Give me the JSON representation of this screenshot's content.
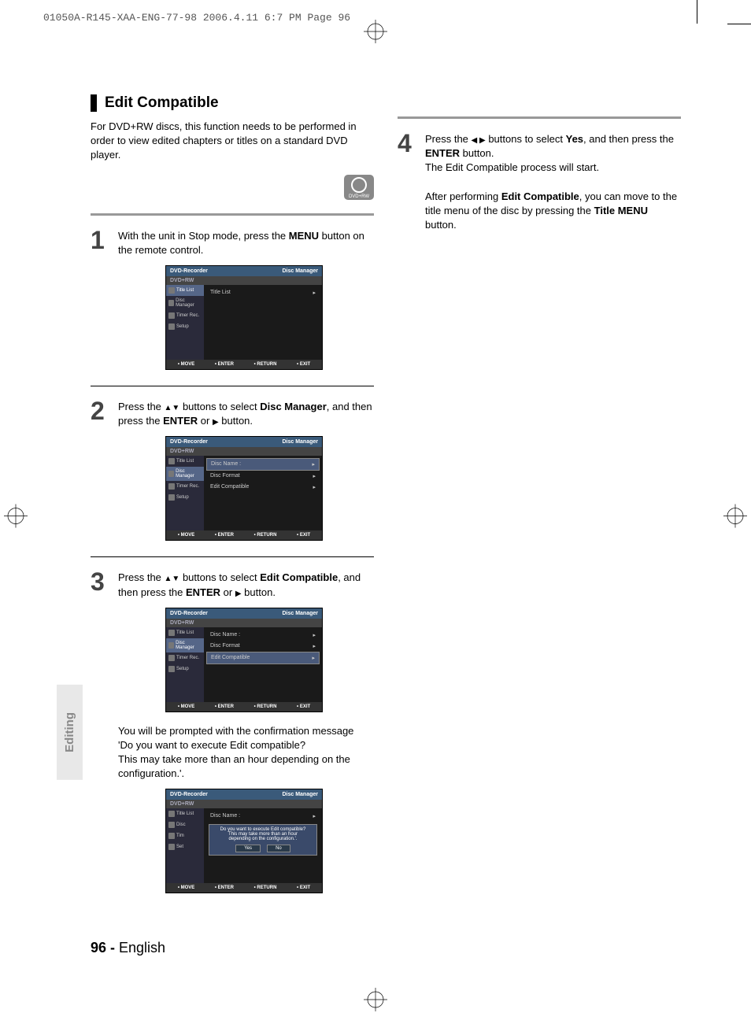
{
  "header": "01050A-R145-XAA-ENG-77-98  2006.4.11  6:7 PM  Page 96",
  "section": {
    "title": "Edit Compatible",
    "intro": "For DVD+RW discs, this function needs to be performed in order to view edited chapters or titles on a standard DVD player.",
    "badge": "DVD+RW"
  },
  "steps": {
    "s1": {
      "num": "1",
      "text_a": "With the unit in Stop mode, press the ",
      "bold_a": "MENU",
      "text_b": " button on the remote control."
    },
    "s2": {
      "num": "2",
      "text_a": "Press the ",
      "arrows_a": "▲▼",
      "text_b": " buttons to select ",
      "bold_a": "Disc Manager",
      "text_c": ", and then press the ",
      "bold_b": "ENTER",
      "text_d": " or ",
      "arrow_b": "▶",
      "text_e": " button."
    },
    "s3": {
      "num": "3",
      "text_a": "Press the ",
      "arrows_a": "▲▼",
      "text_b": " buttons to select ",
      "bold_a": "Edit Compatible",
      "text_c": ", and then press the ",
      "bold_b": "ENTER",
      "text_d": " or ",
      "arrow_b": "▶",
      "text_e": " button."
    },
    "s4": {
      "num": "4",
      "text_a": "Press the ",
      "arrows_a": "◀ ▶",
      "text_b": " buttons to select ",
      "bold_a": "Yes",
      "text_c": ", and then press the ",
      "bold_b": "ENTER",
      "text_d": " button.",
      "line2": "The Edit Compatible process will start.",
      "note_a": "After performing ",
      "note_bold_a": "Edit Compatible",
      "note_b": ", you can move to the title menu of the disc by pressing the ",
      "note_bold_b": "Title MENU",
      "note_c": " button."
    }
  },
  "confirm_text": {
    "l1": "You will be prompted with the confirmation message",
    "l2": "'Do you want to execute Edit compatible?",
    "l3": "This may take more than an hour depending on the configuration.'."
  },
  "screen": {
    "title_left": "DVD-Recorder",
    "title_right": "Disc Manager",
    "subheader": "DVD+RW",
    "sidebar": {
      "i1": "Title List",
      "i2": "Disc Manager",
      "i3": "Timer Rec.",
      "i4": "Setup"
    },
    "main1": {
      "i1": "Title List"
    },
    "main2": {
      "i1": "Disc Name :",
      "i2": "Disc Format",
      "i3": "Edit Compatible"
    },
    "dialog": {
      "l1": "Do you want to execute Edit compatible?",
      "l2": "This may take more than an hour",
      "l3": "depending on the configuration.'.",
      "yes": "Yes",
      "no": "No"
    },
    "footer": {
      "f1": "MOVE",
      "f2": "ENTER",
      "f3": "RETURN",
      "f4": "EXIT"
    }
  },
  "side_tab": "Editing",
  "footer": {
    "page": "96 -",
    "lang": " English"
  }
}
